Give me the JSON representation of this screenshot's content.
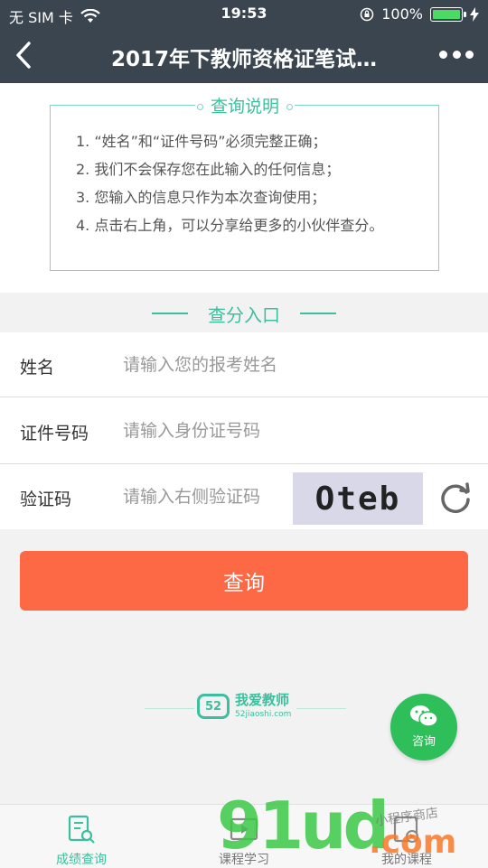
{
  "status_bar": {
    "carrier": "无 SIM 卡",
    "time": "19:53",
    "battery": "100%"
  },
  "nav": {
    "title": "2017年下教师资格证笔试…"
  },
  "notice": {
    "title": "查询说明",
    "items": [
      "1. “姓名”和“证件号码”必须完整正确；",
      "2. 我们不会保存您在此输入的任何信息；",
      "3. 您输入的信息只作为本次查询使用；",
      "4. 点击右上角，可以分享给更多的小伙伴查分。"
    ]
  },
  "entry": {
    "title": "查分入口"
  },
  "form": {
    "name_label": "姓名",
    "name_placeholder": "请输入您的报考姓名",
    "id_label": "证件号码",
    "id_placeholder": "请输入身份证号码",
    "captcha_label": "验证码",
    "captcha_placeholder": "请输入右侧验证码",
    "captcha_text": "Oteb"
  },
  "submit_label": "查询",
  "brand": {
    "name": "我爱教师",
    "url": "52jiaoshi.com",
    "logo_text": "52"
  },
  "fab": {
    "label": "咨询"
  },
  "tabs": [
    {
      "label": "成绩查询",
      "active": true
    },
    {
      "label": "课程学习",
      "active": false
    },
    {
      "label": "我的课程",
      "active": false
    }
  ],
  "watermark": {
    "main": "91ud",
    "suffix": ".com",
    "shop": "小程序商店"
  },
  "colors": {
    "accent": "#3cbf9e",
    "submit": "#fd6845",
    "nav_bg": "#3a4550",
    "fab": "#2fbf5a"
  }
}
